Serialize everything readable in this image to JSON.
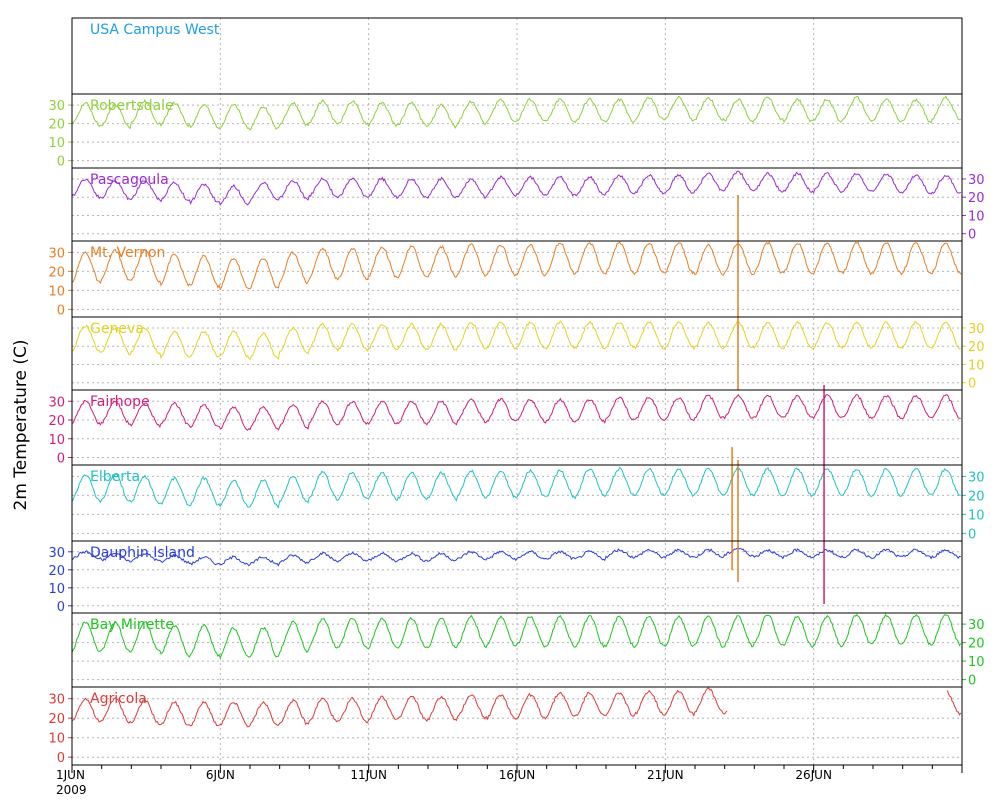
{
  "chart_data": {
    "type": "line",
    "ylabel": "2m Temperature (C)",
    "x_range_days": [
      1,
      31
    ],
    "x_ticks": [
      {
        "day": 1,
        "label": "1JUN"
      },
      {
        "day": 6,
        "label": "6JUN"
      },
      {
        "day": 11,
        "label": "11JUN"
      },
      {
        "day": 16,
        "label": "16JUN"
      },
      {
        "day": 21,
        "label": "21JUN"
      },
      {
        "day": 26,
        "label": "26JUN"
      }
    ],
    "year_label": "2009",
    "y_ticks": [
      0,
      10,
      20,
      30
    ],
    "y_range": [
      -4,
      36
    ],
    "grid": true,
    "series": [
      {
        "name": "USA Campus West",
        "color": "#1e9ee8",
        "axis": "none",
        "mean": null,
        "amp": 0,
        "values": []
      },
      {
        "name": "Robertsdale",
        "color": "#8ed13a",
        "axis": "left",
        "mean": 24,
        "amp": 6,
        "daily_high": [
          31,
          30,
          32,
          31,
          30,
          30,
          29,
          31,
          32,
          32,
          31,
          31,
          30,
          32,
          33,
          33,
          33,
          33,
          33,
          34,
          34,
          34,
          33,
          34,
          33,
          33,
          34,
          33,
          33,
          34
        ]
      },
      {
        "name": "Pascagoula",
        "color": "#9a2bd0",
        "axis": "right",
        "mean": 24,
        "amp": 5,
        "daily_high": [
          30,
          29,
          29,
          28,
          27,
          26,
          28,
          29,
          30,
          30,
          30,
          30,
          30,
          30,
          31,
          31,
          31,
          31,
          32,
          32,
          32,
          33,
          34,
          33,
          33,
          33,
          33,
          33,
          32,
          32
        ]
      },
      {
        "name": "Mt. Vernon",
        "color": "#e47f27",
        "axis": "left",
        "mean": 22,
        "amp": 8,
        "daily_high": [
          30,
          31,
          31,
          29,
          28,
          27,
          27,
          30,
          32,
          32,
          33,
          33,
          33,
          34,
          34,
          34,
          35,
          35,
          35,
          35,
          35,
          34,
          35,
          35,
          35,
          35,
          35,
          35,
          35,
          35
        ]
      },
      {
        "name": "Geneva",
        "color": "#e5d21f",
        "axis": "right",
        "mean": 23,
        "amp": 7,
        "daily_high": [
          31,
          30,
          30,
          28,
          28,
          28,
          27,
          30,
          32,
          32,
          32,
          32,
          32,
          33,
          33,
          33,
          33,
          33,
          33,
          33,
          33,
          33,
          33,
          33,
          33,
          33,
          33,
          33,
          33,
          33
        ]
      },
      {
        "name": "Fairhope",
        "color": "#d01e7b",
        "axis": "left",
        "mean": 25,
        "amp": 6,
        "daily_high": [
          30,
          30,
          29,
          29,
          28,
          27,
          27,
          28,
          30,
          30,
          30,
          30,
          30,
          31,
          31,
          31,
          31,
          31,
          32,
          32,
          32,
          33,
          33,
          33,
          33,
          33,
          33,
          33,
          33,
          33
        ]
      },
      {
        "name": "Elberta",
        "color": "#21c2c2",
        "axis": "right",
        "mean": 24,
        "amp": 7,
        "daily_high": [
          31,
          31,
          30,
          29,
          29,
          28,
          28,
          30,
          32,
          32,
          32,
          32,
          32,
          33,
          33,
          33,
          33,
          34,
          34,
          34,
          34,
          34,
          34,
          34,
          34,
          34,
          34,
          34,
          34,
          34
        ]
      },
      {
        "name": "Dauphin Island",
        "color": "#2a3fd8",
        "axis": "left",
        "mean": 27,
        "amp": 2,
        "daily_high": [
          30,
          29,
          29,
          28,
          27,
          27,
          27,
          28,
          29,
          29,
          29,
          29,
          29,
          30,
          30,
          30,
          30,
          30,
          31,
          31,
          31,
          31,
          32,
          31,
          31,
          31,
          31,
          31,
          31,
          31
        ]
      },
      {
        "name": "Bay Minette",
        "color": "#1fc41f",
        "axis": "right",
        "mean": 24,
        "amp": 8,
        "daily_high": [
          31,
          31,
          31,
          29,
          29,
          28,
          28,
          31,
          33,
          33,
          33,
          33,
          33,
          34,
          34,
          34,
          34,
          34,
          34,
          34,
          34,
          34,
          34,
          35,
          34,
          34,
          35,
          35,
          35,
          35
        ]
      },
      {
        "name": "Agricola",
        "color": "#dd3a3a",
        "axis": "left",
        "mean": 24,
        "amp": 6,
        "daily_high": [
          30,
          30,
          29,
          28,
          28,
          28,
          28,
          29,
          30,
          30,
          31,
          31,
          31,
          32,
          32,
          32,
          33,
          33,
          33,
          34,
          34,
          35,
          34,
          34,
          34,
          34,
          34,
          34,
          34,
          34
        ]
      }
    ]
  }
}
